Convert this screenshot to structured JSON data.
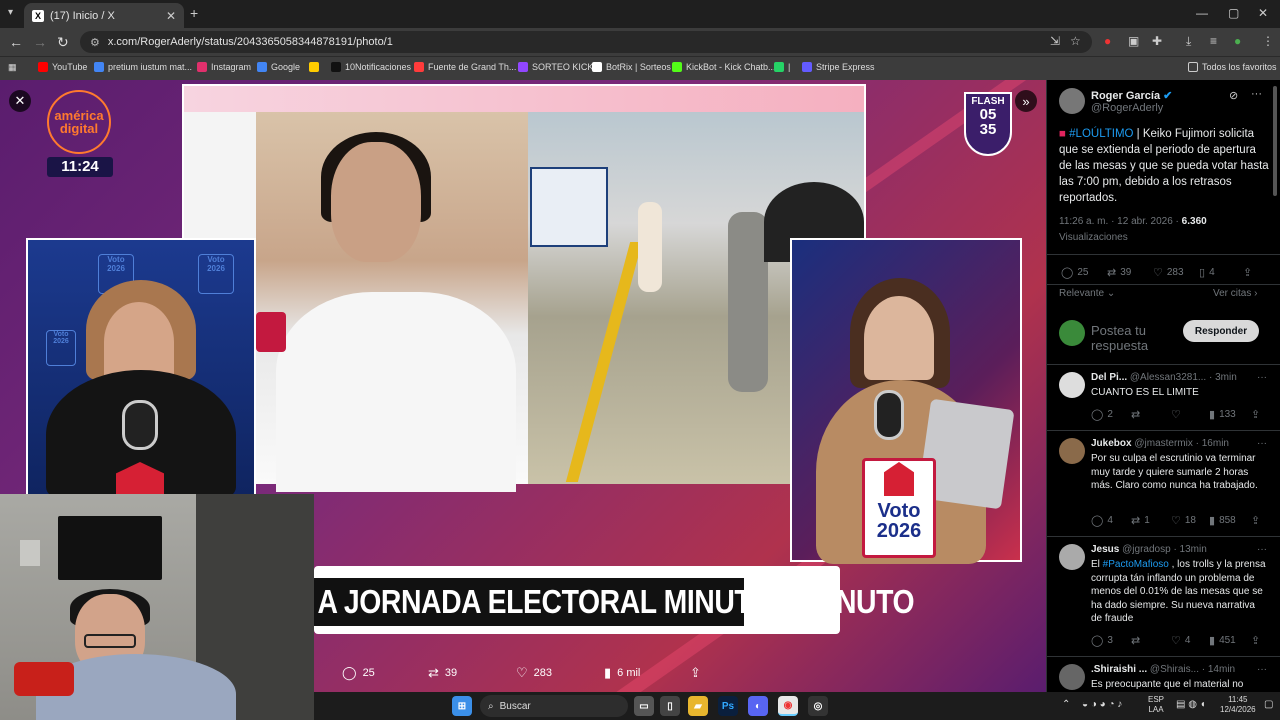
{
  "browser": {
    "tab_title": "(17) Inicio / X",
    "tab_favicon": "X",
    "url": "x.com/RogerAderly/status/2043365058344878191/photo/1",
    "bookmarks": [
      {
        "label": "YouTube",
        "color": "#ff0000"
      },
      {
        "label": "pretium iustum mat...",
        "color": "#4285f4"
      },
      {
        "label": "Instagram",
        "color": "#e1306c"
      },
      {
        "label": "Google",
        "color": "#4285f4"
      },
      {
        "label": "",
        "color": "#ffcc00"
      },
      {
        "label": "10Notificaciones",
        "color": "#111111"
      },
      {
        "label": "Fuente de Grand Th...",
        "color": "#ff3b3b"
      },
      {
        "label": "SORTEO KICK",
        "color": "#9146ff"
      },
      {
        "label": "BotRix | Sorteos",
        "color": "#ffffff"
      },
      {
        "label": "KickBot - Kick Chatb...",
        "color": "#53fc18"
      },
      {
        "label": "|",
        "color": "#25d366"
      },
      {
        "label": "Stripe Express",
        "color": "#635bff"
      }
    ],
    "all_bookmarks": "Todos los favoritos"
  },
  "media": {
    "channel_logo_line1": "américa",
    "channel_logo_line2": "digital",
    "clock": "11:24",
    "flash_label": "FLASH",
    "flash_hour": "05",
    "flash_min": "35",
    "voto_label": "Voto",
    "voto_year": "2026",
    "lower_third": "A JORNADA ELECTORAL MINUTO A MINUTO",
    "actions": {
      "replies": "25",
      "reposts": "39",
      "likes": "283",
      "views": "6 mil"
    }
  },
  "tweet": {
    "author": "Roger García",
    "handle": "@RogerAderly",
    "hashtag": "#LOÚLTIMO",
    "text": " | Keiko Fujimori solicita que se extienda el periodo de apertura de las mesas y que se pueda votar hasta las 7:00 pm, debido a los retrasos reportados.",
    "timestamp": "11:26 a. m. · 12 abr. 2026 · ",
    "views_count": "6.360",
    "views_label": "Visualizaciones",
    "stats": {
      "replies": "25",
      "reposts": "39",
      "likes": "283",
      "bookmarks": "4"
    },
    "sort_label": "Relevante",
    "see_quotes": "Ver citas",
    "reply_placeholder": "Postea tu respuesta",
    "reply_button": "Responder"
  },
  "replies": [
    {
      "name": "Del Pi...",
      "handle": "@Alessan3281...",
      "time": "· 3min",
      "text": "CUANTO ES EL LIMITE",
      "replies": "2",
      "reposts": "",
      "likes": "",
      "views": "133"
    },
    {
      "name": "Jukebox",
      "handle": "@jmastermix",
      "time": "· 16min",
      "text": "Por su culpa el escrutinio va terminar muy tarde y quiere sumarle 2 horas más. Claro como nunca ha trabajado.",
      "replies": "4",
      "reposts": "1",
      "likes": "18",
      "views": "858"
    },
    {
      "name": "Jesus",
      "handle": "@jgradosp",
      "time": "· 13min",
      "text_pre": "El ",
      "hashtag": "#PactoMafioso",
      "text": " , los trolls y la prensa corrupta tán inflando un problema de menos del 0.01% de las mesas que se ha dado siempre. Su nueva narrativa de fraude",
      "replies": "3",
      "reposts": "",
      "likes": "4",
      "views": "451"
    },
    {
      "name": ".Shiraishi ...",
      "handle": "@Shirais...",
      "time": "· 14min",
      "text": "Es preocupante que el material no"
    }
  ],
  "taskbar": {
    "search_placeholder": "Buscar",
    "lang_line1": "ESP",
    "lang_line2": "LAA",
    "time": "11:45",
    "date": "12/4/2026"
  }
}
